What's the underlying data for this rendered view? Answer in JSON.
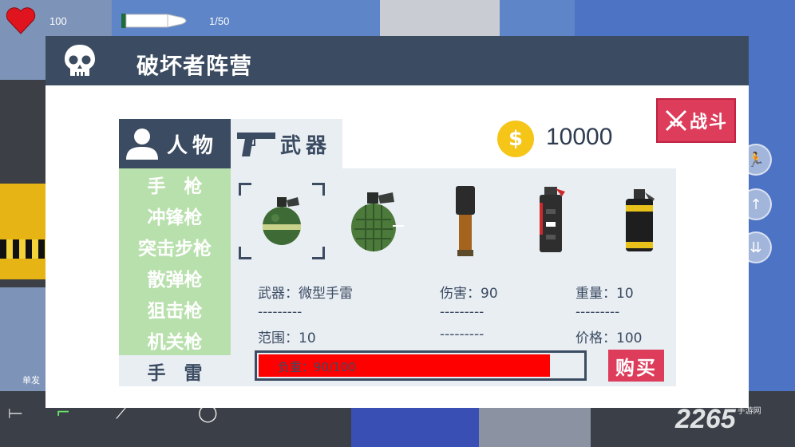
{
  "hud": {
    "health": "100",
    "ammo": "1/50",
    "single_label": "单发"
  },
  "modal": {
    "title": "破坏者阵营",
    "fight_label": "战斗",
    "money": "10000",
    "coin_symbol": "$"
  },
  "tabs": {
    "person": "人物",
    "weapon": "武器"
  },
  "categories": [
    {
      "label": "手　枪",
      "active": false
    },
    {
      "label": "冲锋枪",
      "active": false
    },
    {
      "label": "突击步枪",
      "active": false
    },
    {
      "label": "散弹枪",
      "active": false
    },
    {
      "label": "狙击枪",
      "active": false
    },
    {
      "label": "机关枪",
      "active": false
    },
    {
      "label": "手　雷",
      "active": true
    }
  ],
  "items": [
    {
      "icon": "frag-grenade-small-icon",
      "selected": true
    },
    {
      "icon": "frag-grenade-icon",
      "selected": false
    },
    {
      "icon": "stick-grenade-icon",
      "selected": false
    },
    {
      "icon": "flashbang-icon",
      "selected": false
    },
    {
      "icon": "smoke-grenade-icon",
      "selected": false
    }
  ],
  "stats": {
    "weapon": "武器：微型手雷",
    "damage": "伤害：90",
    "weight": "重量：10",
    "dash1": "---------",
    "dash2": "---------",
    "dash3": "---------",
    "range": "范围：10",
    "dash4": "---------",
    "price": "价格：100"
  },
  "load": {
    "label": "负重：90/100",
    "value": 90,
    "max": 100
  },
  "buy_label": "购买",
  "watermark": {
    "text": "2265",
    "sub": "手游网"
  },
  "colors": {
    "header": "#3b4b61",
    "accent_red": "#dd3c5b",
    "category_green": "#b8e0ac",
    "coin_yellow": "#f5c518",
    "load_red": "#ff0000"
  }
}
